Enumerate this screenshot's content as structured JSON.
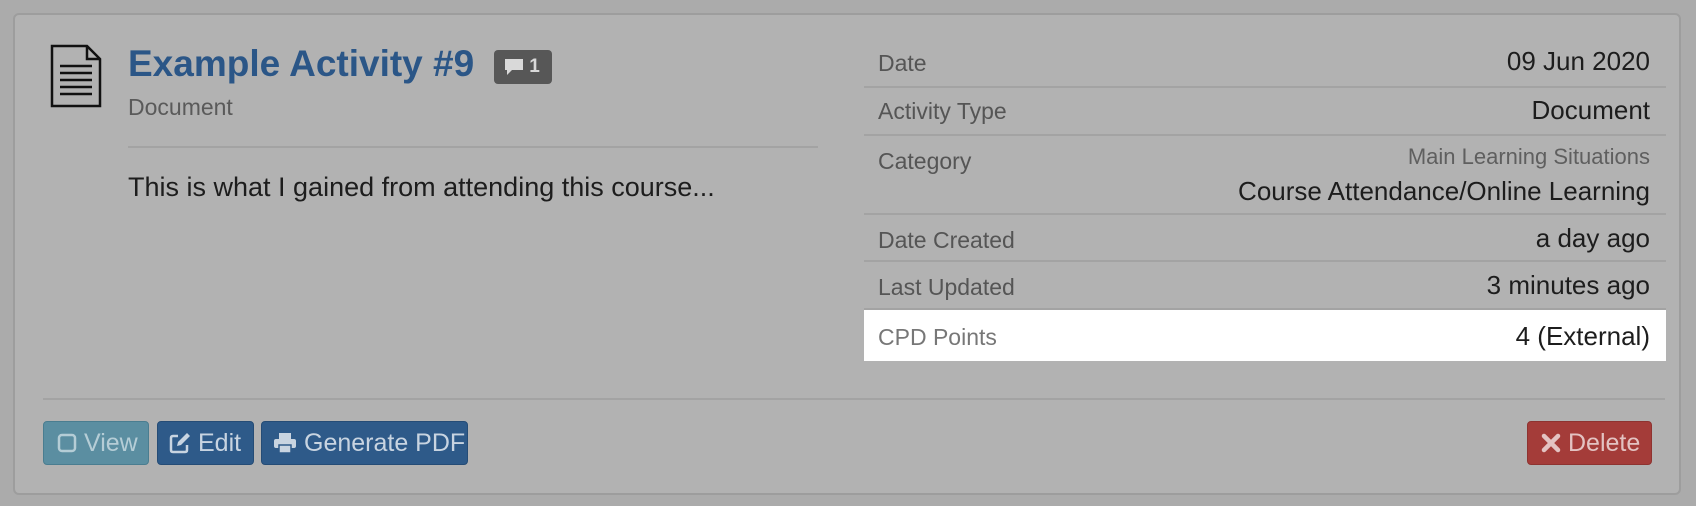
{
  "activity": {
    "title": "Example Activity #9",
    "comment_count": "1",
    "subtitle": "Document",
    "description": "This is what I gained from attending this course..."
  },
  "details": {
    "date_label": "Date",
    "date_value": "09 Jun 2020",
    "activity_type_label": "Activity Type",
    "activity_type_value": "Document",
    "category_label": "Category",
    "category_parent": "Main Learning Situations",
    "category_value": "Course Attendance/Online Learning",
    "date_created_label": "Date Created",
    "date_created_value": "a day ago",
    "last_updated_label": "Last Updated",
    "last_updated_value": "3 minutes ago",
    "cpd_points_label": "CPD Points",
    "cpd_points_value": "4 (External)"
  },
  "actions": {
    "view_label": "View",
    "edit_label": "Edit",
    "pdf_label": "Generate PDF",
    "delete_label": "Delete"
  },
  "icons": {
    "activity": "document-icon",
    "comments": "comment-icon",
    "view": "square-icon",
    "edit": "edit-icon",
    "pdf": "printer-icon",
    "delete": "close-icon"
  },
  "colors": {
    "title": "#2b5687",
    "view_button": "#5b8ea1",
    "primary_button": "#2e5a89",
    "delete_button": "#a43c39",
    "highlight_row": "#ffffff"
  }
}
